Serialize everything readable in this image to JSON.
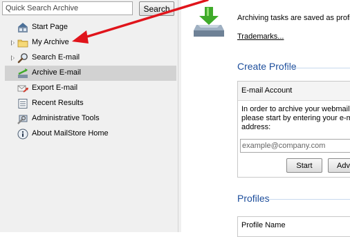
{
  "sidebar": {
    "search_placeholder": "Quick Search Archive",
    "search_button": "Search",
    "items": [
      {
        "label": "Start Page",
        "icon": "start-page-icon",
        "expandable": false,
        "selected": false
      },
      {
        "label": "My Archive",
        "icon": "folder-icon",
        "expandable": true,
        "selected": false
      },
      {
        "label": "Search E-mail",
        "icon": "search-icon",
        "expandable": true,
        "selected": false
      },
      {
        "label": "Archive E-mail",
        "icon": "archive-email-icon",
        "expandable": false,
        "selected": true
      },
      {
        "label": "Export E-mail",
        "icon": "export-email-icon",
        "expandable": false,
        "selected": false
      },
      {
        "label": "Recent Results",
        "icon": "recent-results-icon",
        "expandable": false,
        "selected": false
      },
      {
        "label": "Administrative Tools",
        "icon": "admin-tools-icon",
        "expandable": false,
        "selected": false
      },
      {
        "label": "About MailStore Home",
        "icon": "info-icon",
        "expandable": false,
        "selected": false
      }
    ]
  },
  "main": {
    "intro_text": "Archiving tasks are saved as profil",
    "trademarks_link": "Trademarks...",
    "create_profile_title": "Create Profile",
    "email_account_label": "E-mail Account",
    "description_lines": [
      "In order to archive your webmail a",
      "please start by entering your e-m",
      "address:"
    ],
    "email_placeholder": "example@company.com",
    "start_button": "Start",
    "advanced_button": "Adva",
    "profiles_title": "Profiles",
    "profile_name_header": "Profile Name"
  },
  "colors": {
    "section_title": "#1c4d9b",
    "selection": "#d2d2d2",
    "annotation_arrow": "#e0141b",
    "archive_icon_green": "#3faa2a"
  }
}
